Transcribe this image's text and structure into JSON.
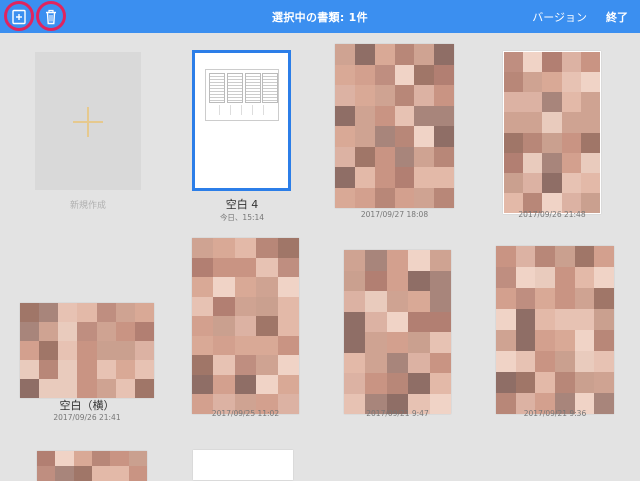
{
  "toolbar": {
    "title": "選択中の書類: 1件",
    "version_label": "バージョン",
    "done_label": "終了",
    "accent_color": "#3b8ff0",
    "highlight_color": "#e0245e"
  },
  "new_document": {
    "label": "新規作成"
  },
  "documents": [
    {
      "name": "空白 4",
      "date": "今日、15:14",
      "selected": true
    },
    {
      "name": "",
      "date": "2017/09/27 18:08",
      "selected": false
    },
    {
      "name": "",
      "date": "2017/09/26 21:48",
      "selected": false
    },
    {
      "name": "空白（横）",
      "date": "2017/09/26 21:41",
      "selected": false
    },
    {
      "name": "",
      "date": "2017/09/25 11:02",
      "selected": false
    },
    {
      "name": "",
      "date": "2017/09/21 9:47",
      "selected": false
    },
    {
      "name": "",
      "date": "2017/09/21 9:36",
      "selected": false
    }
  ]
}
